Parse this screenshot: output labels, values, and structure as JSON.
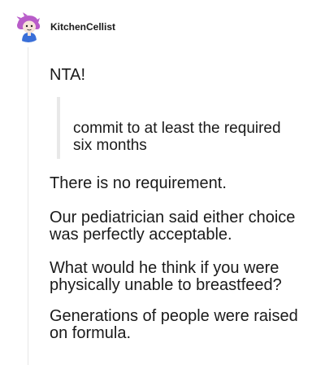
{
  "post": {
    "username": "KitchenCellist",
    "avatar_icon": "cartoon-character-avatar-icon",
    "opening": "NTA!",
    "quote": "commit to at least the required six months",
    "paragraphs": [
      "There is no requirement.",
      "Our pediatrician said either choice was perfectly acceptable.",
      "What would he think if you were physically unable to breastfeed?",
      "Generations of people were raised on formula."
    ]
  },
  "colors": {
    "text": "#1a1a1a",
    "quote_bar": "#e8e8e8",
    "avatar_hair": "#b85cc9",
    "avatar_body": "#3a6fd8"
  }
}
